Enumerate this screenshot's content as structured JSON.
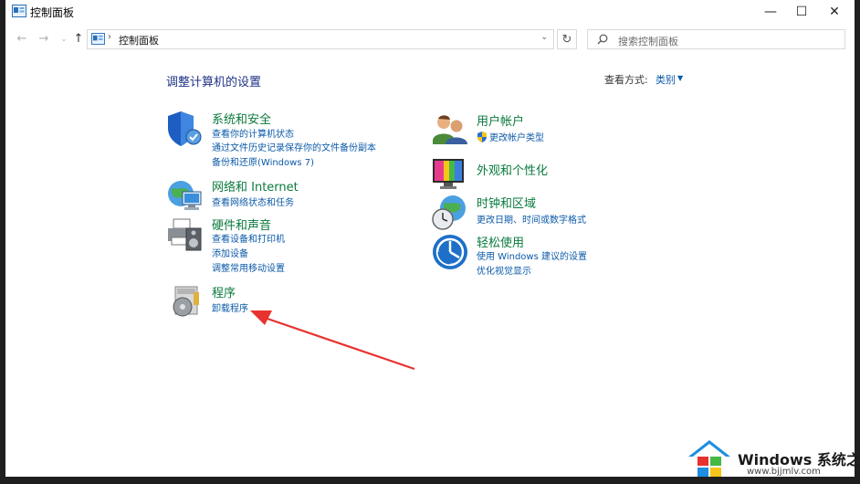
{
  "window": {
    "title": "控制面板"
  },
  "nav": {
    "back_glyph": "←",
    "forward_glyph": "→",
    "recent_glyph": "⌄",
    "up_glyph": "↑",
    "address_sep": "›",
    "address_text": "控制面板",
    "address_drop": "⌄",
    "refresh_glyph": "↻",
    "search_placeholder": "搜索控制面板"
  },
  "win_controls": {
    "minimize": "—",
    "maximize": "☐",
    "close": "✕"
  },
  "content": {
    "title": "调整计算机的设置",
    "viewby_label": "查看方式:",
    "viewby_value": "类别",
    "viewby_arrow": "▼"
  },
  "categories_left": [
    {
      "title": "系统和安全",
      "links": [
        "查看你的计算机状态",
        "通过文件历史记录保存你的文件备份副本",
        "备份和还原(Windows 7)"
      ]
    },
    {
      "title": "网络和 Internet",
      "links": [
        "查看网络状态和任务"
      ]
    },
    {
      "title": "硬件和声音",
      "links": [
        "查看设备和打印机",
        "添加设备",
        "调整常用移动设置"
      ]
    },
    {
      "title": "程序",
      "links": [
        "卸载程序"
      ]
    }
  ],
  "categories_right": [
    {
      "title": "用户帐户",
      "links": [
        "更改帐户类型"
      ]
    },
    {
      "title": "外观和个性化",
      "links": []
    },
    {
      "title": "时钟和区域",
      "links": [
        "更改日期、时间或数字格式"
      ]
    },
    {
      "title": "轻松使用",
      "links": [
        "使用 Windows 建议的设置",
        "优化视觉显示"
      ]
    }
  ],
  "watermark": {
    "line1": "Windows 系统之家",
    "line2": "www.bjjmlv.com"
  },
  "colors": {
    "link": "#0b5aa8",
    "category_title": "#0a7a3c",
    "annotation_arrow": "#e8322f"
  }
}
